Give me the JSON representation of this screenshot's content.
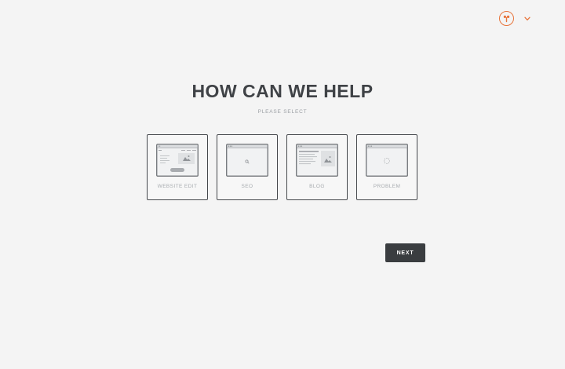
{
  "header": {
    "avatar_icon": "user-avatar-icon",
    "menu_icon": "chevron-down-icon",
    "accent_color": "#e8743b"
  },
  "main": {
    "title": "HOW CAN WE HELP",
    "subtitle": "PLEASE SELECT",
    "options": [
      {
        "label": "WEBSITE EDIT",
        "icon": "website-edit-illustration"
      },
      {
        "label": "SEO",
        "icon": "seo-search-illustration"
      },
      {
        "label": "BLOG",
        "icon": "blog-article-illustration"
      },
      {
        "label": "PROBLEM",
        "icon": "problem-loading-illustration"
      }
    ],
    "next_label": "NEXT"
  }
}
